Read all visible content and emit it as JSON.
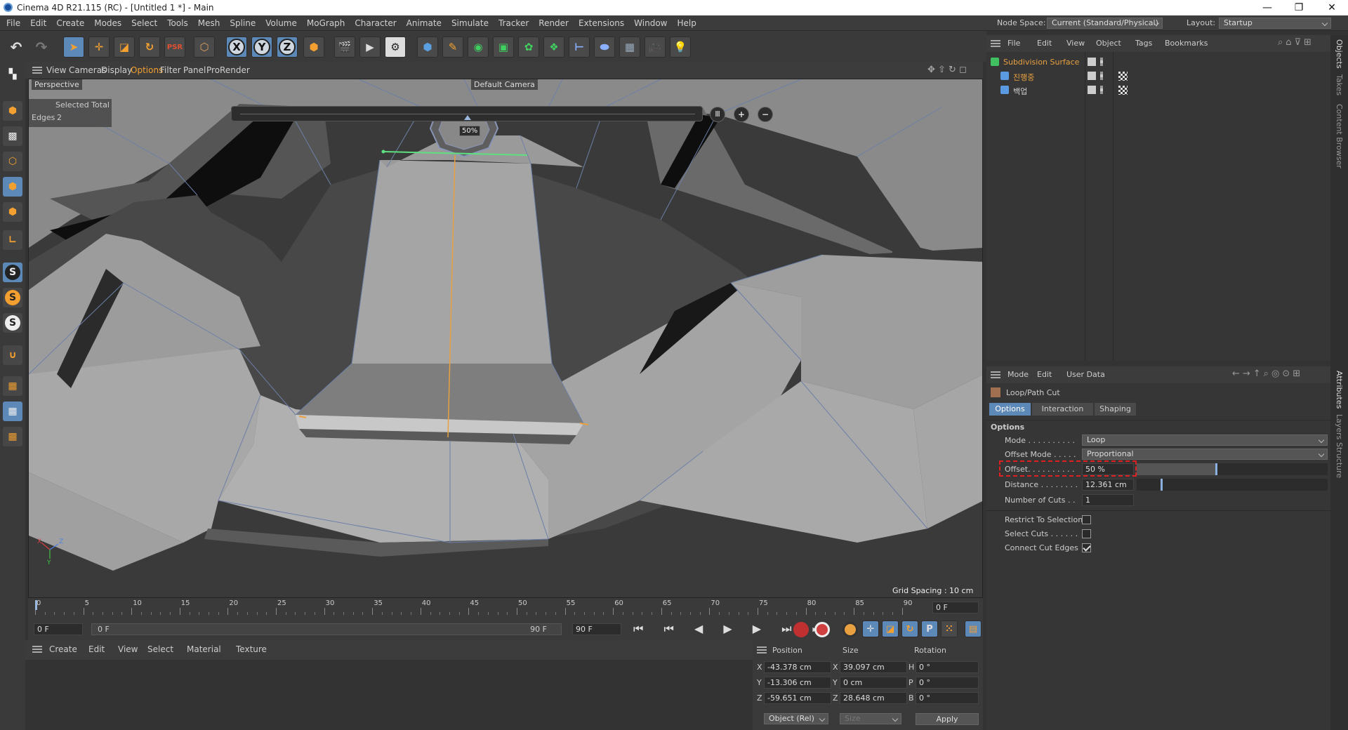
{
  "window": {
    "title": "Cinema 4D R21.115 (RC) - [Untitled 1 *] - Main",
    "minimize": "—",
    "restore": "❐",
    "close": "✕"
  },
  "menu": {
    "items": [
      "File",
      "Edit",
      "Create",
      "Modes",
      "Select",
      "Tools",
      "Mesh",
      "Spline",
      "Volume",
      "MoGraph",
      "Character",
      "Animate",
      "Simulate",
      "Tracker",
      "Render",
      "Extensions",
      "Window",
      "Help"
    ],
    "node_space_label": "Node Space:",
    "node_space_value": "Current (Standard/Physical)",
    "layout_label": "Layout:",
    "layout_value": "Startup"
  },
  "toolbar": {
    "x_label": "X",
    "y_label": "Y",
    "z_label": "Z"
  },
  "viewport": {
    "menu": [
      "View",
      "Cameras",
      "Display",
      "Options",
      "Filter",
      "Panel",
      "ProRender"
    ],
    "projection": "Perspective",
    "camera": "Default Camera",
    "stats_header": "Selected Total",
    "stats_label": "Edges",
    "stats_value": "2",
    "slider_label": "50%",
    "slider_value": 0.5,
    "grid_spacing": "Grid Spacing : 10 cm",
    "axis_x": "X",
    "axis_y": "Y",
    "axis_z": "Z"
  },
  "timeline": {
    "ticks": [
      "0",
      "5",
      "10",
      "15",
      "20",
      "25",
      "30",
      "35",
      "40",
      "45",
      "50",
      "55",
      "60",
      "65",
      "70",
      "75",
      "80",
      "85",
      "90"
    ],
    "current_frame": "0 F",
    "start": "0 F",
    "range_start": "0 F",
    "range_end": "90 F",
    "end": "90 F"
  },
  "material": {
    "menu": [
      "Create",
      "Edit",
      "View",
      "Select",
      "Material",
      "Texture"
    ]
  },
  "coords": {
    "headers": [
      "Position",
      "Size",
      "Rotation"
    ],
    "rows": [
      {
        "axis": "X",
        "pos": "-43.378 cm",
        "size_axis": "X",
        "size": "39.097 cm",
        "rot_axis": "H",
        "rot": "0 °"
      },
      {
        "axis": "Y",
        "pos": "-13.306 cm",
        "size_axis": "Y",
        "size": "0 cm",
        "rot_axis": "P",
        "rot": "0 °"
      },
      {
        "axis": "Z",
        "pos": "-59.651 cm",
        "size_axis": "Z",
        "size": "28.648 cm",
        "rot_axis": "B",
        "rot": "0 °"
      }
    ],
    "mode": "Object (Rel)",
    "size_mode": "Size",
    "apply": "Apply"
  },
  "objects": {
    "menu": [
      "File",
      "Edit",
      "View",
      "Object",
      "Tags",
      "Bookmarks"
    ],
    "tree": [
      {
        "name": "Subdivision Surface",
        "color": "#e8a040"
      },
      {
        "name": "진행중",
        "color": "#e8a040"
      },
      {
        "name": "백업",
        "color": "#d0d0d0"
      }
    ]
  },
  "attributes": {
    "menu": [
      "Mode",
      "Edit",
      "User Data"
    ],
    "tool_name": "Loop/Path Cut",
    "tabs": [
      "Options",
      "Interaction",
      "Shaping"
    ],
    "section": "Options",
    "fields": {
      "mode_label": "Mode . . . . . . . . . .",
      "mode_value": "Loop",
      "offset_mode_label": "Offset Mode . . . . .",
      "offset_mode_value": "Proportional",
      "offset_label": "Offset. . . . . . . . . .",
      "offset_value": "50 %",
      "offset_fraction": 0.5,
      "distance_label": "Distance . . . . . . . .",
      "distance_value": "12.361 cm",
      "cuts_label": "Number of Cuts . .",
      "cuts_value": "1",
      "restrict_label": "Restrict To Selection",
      "select_cuts_label": "Select Cuts . . . . . .",
      "connect_label": "Connect Cut Edges"
    }
  },
  "sidetabs": [
    "Objects",
    "Takes",
    "Content Browser",
    "Attributes",
    "Layers",
    "Structure"
  ],
  "colors": {
    "accent": "#5d89b8",
    "highlight_box": "#e02020",
    "orange": "#e8a040"
  }
}
